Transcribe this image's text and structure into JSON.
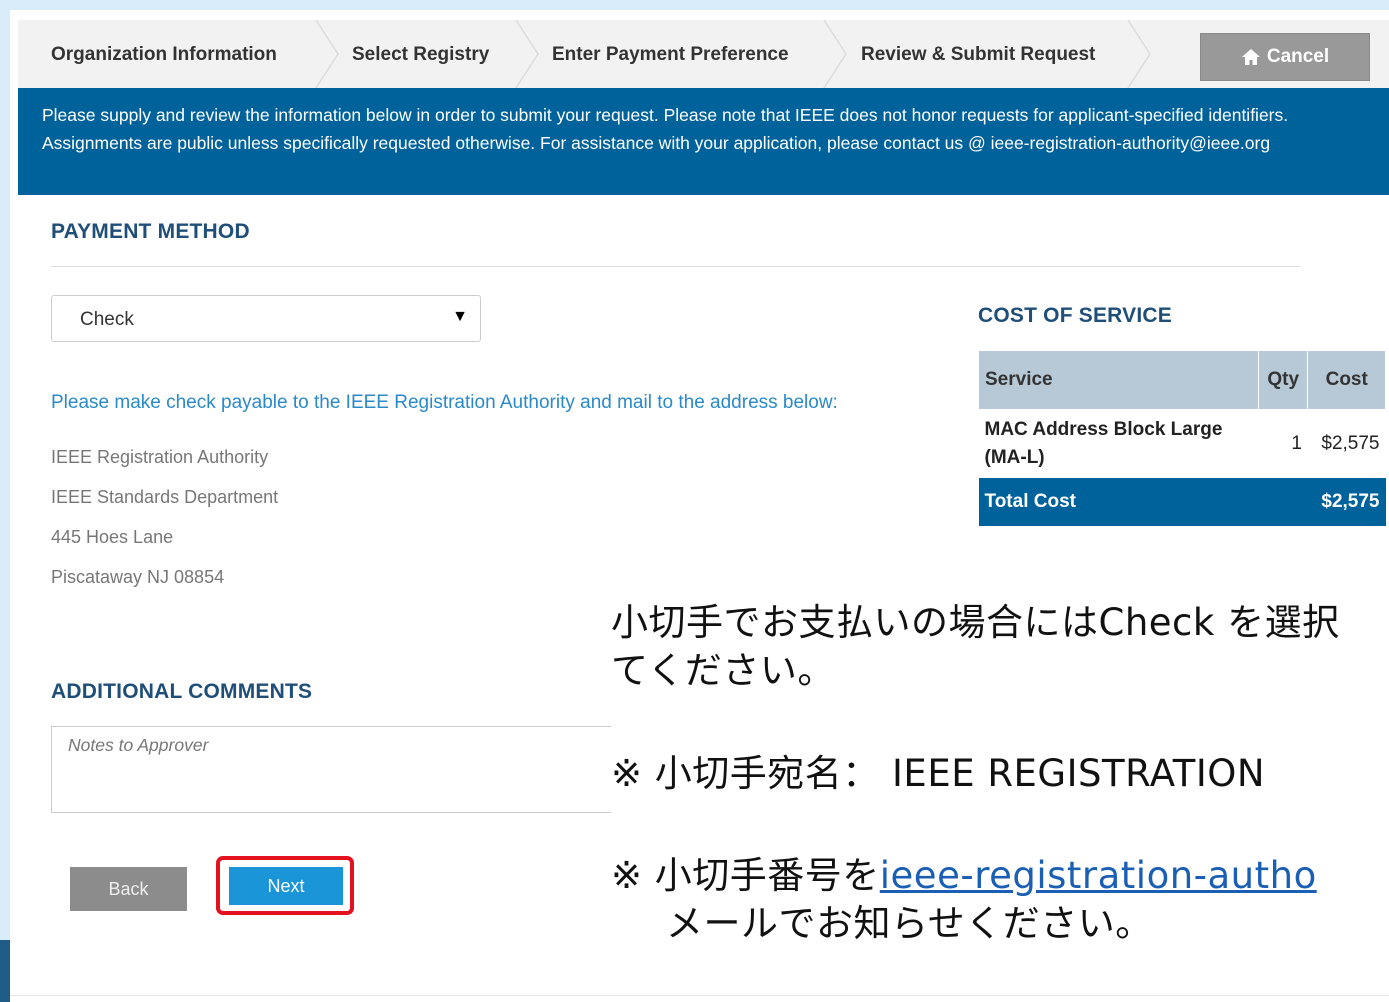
{
  "wizard": {
    "steps": [
      {
        "label": "Organization Information"
      },
      {
        "label": "Select Registry"
      },
      {
        "label": "Enter Payment Preference"
      },
      {
        "label": "Review & Submit Request"
      }
    ],
    "cancel_label": "Cancel"
  },
  "banner": {
    "text": "Please supply and review the information below in order to submit your request. Please note that IEEE does not honor requests for applicant-specified identifiers. Assignments are public unless specifically requested otherwise. For assistance with your application, please contact us @ ieee-registration-authority@ieee.org"
  },
  "payment": {
    "title": "PAYMENT METHOD",
    "selected": "Check",
    "payable_note": "Please make check payable to the IEEE Registration Authority and mail to the address below:",
    "address": [
      "IEEE Registration Authority",
      "IEEE Standards Department",
      "445 Hoes Lane",
      "Piscataway NJ 08854"
    ]
  },
  "cost": {
    "title": "COST OF SERVICE",
    "headers": {
      "service": "Service",
      "qty": "Qty",
      "cost": "Cost"
    },
    "rows": [
      {
        "service": "MAC Address Block Large (MA-L)",
        "qty": "1",
        "cost": "$2,575"
      }
    ],
    "total_label": "Total Cost",
    "total_value": "$2,575"
  },
  "comments": {
    "title": "ADDITIONAL COMMENTS",
    "placeholder": "Notes to Approver"
  },
  "buttons": {
    "back": "Back",
    "next": "Next"
  },
  "annotation": {
    "line1": "小切手でお支払いの場合にはCheck を選択",
    "line2": "てください。",
    "line3": "※ 小切手宛名：  IEEE REGISTRATION",
    "line4_prefix": "※ 小切手番号を",
    "line4_link": "ieee-registration-autho",
    "line5": "メールでお知らせください。"
  },
  "colors": {
    "banner": "#00629b",
    "accent_blue": "#2a8ac9",
    "highlight_red": "#e3121e",
    "next_button": "#1a96d8"
  }
}
